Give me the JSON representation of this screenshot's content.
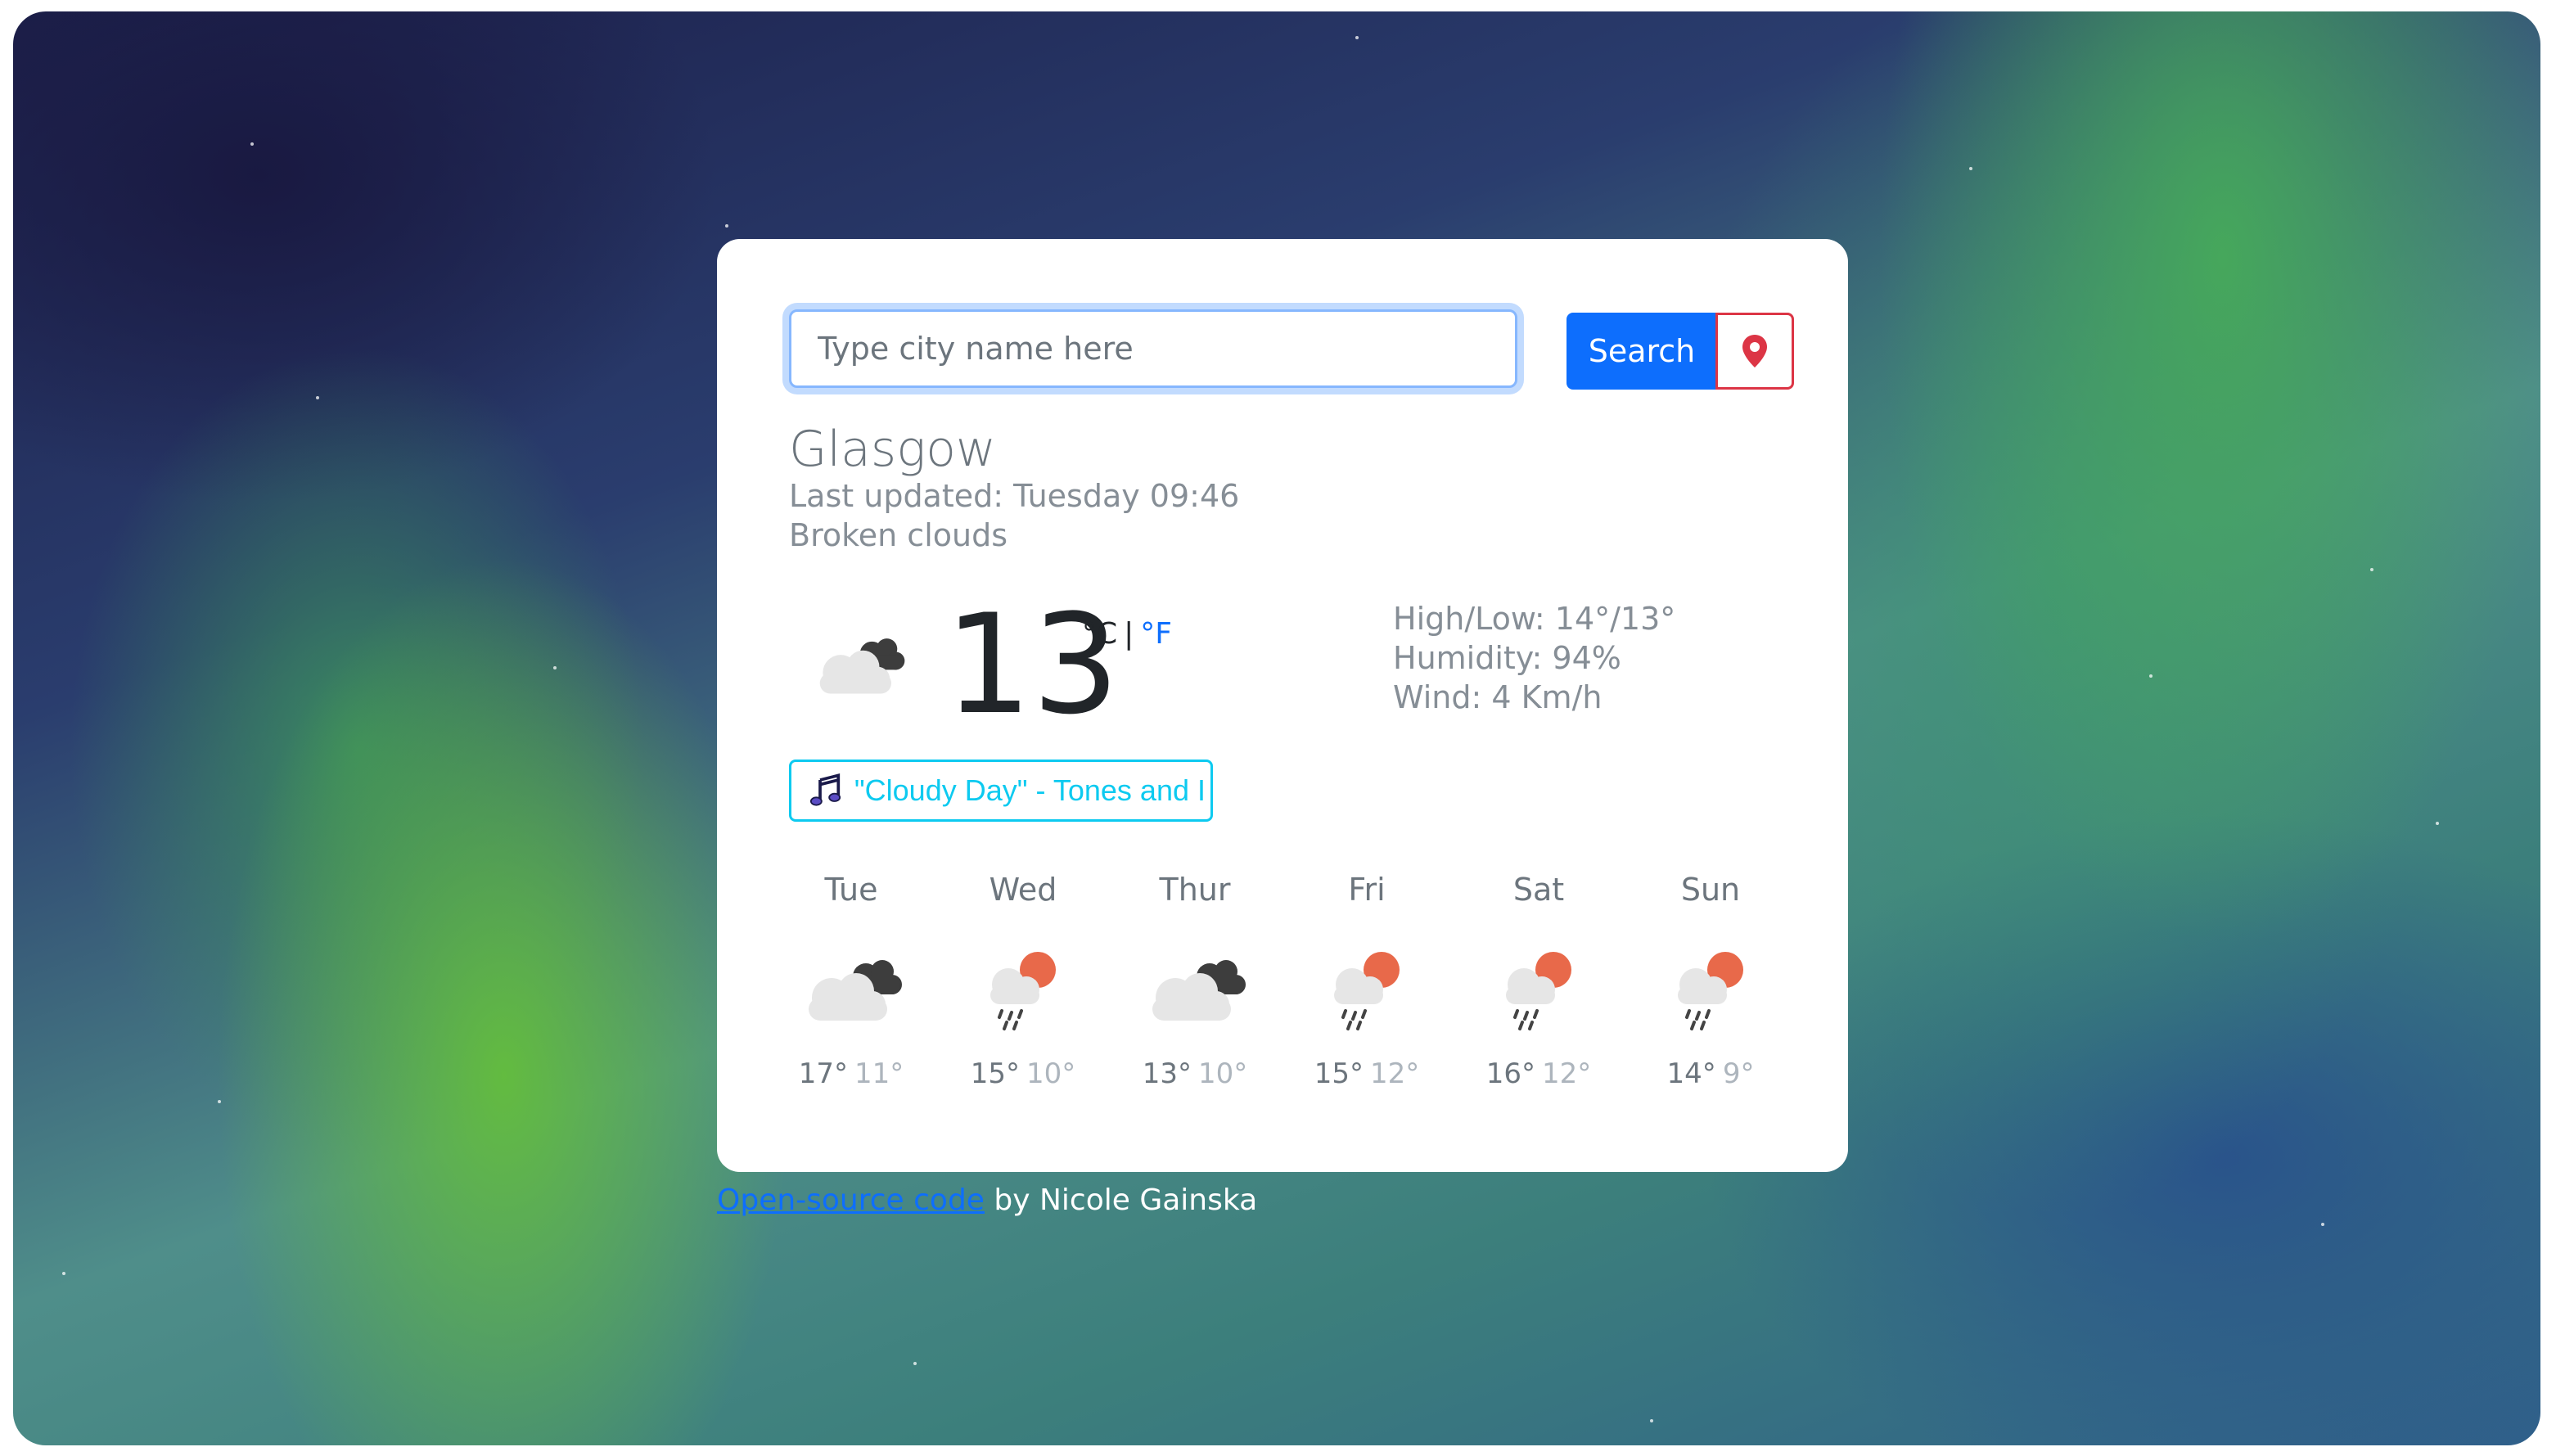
{
  "search": {
    "placeholder": "Type city name here",
    "button_label": "Search"
  },
  "current": {
    "city": "Glasgow",
    "last_updated": "Last updated: Tuesday 09:46",
    "description": "Broken clouds",
    "icon": "broken-clouds-icon",
    "temperature": "13",
    "unit_c": "°C",
    "unit_sep": "|",
    "unit_f": "°F",
    "high_low": "High/Low: 14°/13°",
    "humidity": "Humidity: 94%",
    "wind": "Wind: 4 Km/h"
  },
  "song": {
    "icon": "music-note-icon",
    "label": "\"Cloudy Day\" - Tones and I"
  },
  "forecast": [
    {
      "day": "Tue",
      "icon": "broken-clouds-icon",
      "high": "17°",
      "low": "11°"
    },
    {
      "day": "Wed",
      "icon": "sun-rain-icon",
      "high": "15°",
      "low": "10°"
    },
    {
      "day": "Thur",
      "icon": "broken-clouds-icon",
      "high": "13°",
      "low": "10°"
    },
    {
      "day": "Fri",
      "icon": "sun-rain-icon",
      "high": "15°",
      "low": "12°"
    },
    {
      "day": "Sat",
      "icon": "sun-rain-icon",
      "high": "16°",
      "low": "12°"
    },
    {
      "day": "Sun",
      "icon": "sun-rain-icon",
      "high": "14°",
      "low": "9°"
    }
  ],
  "footer": {
    "link_text": "Open-source code",
    "suffix": " by Nicole Gainska"
  },
  "colors": {
    "primary": "#0d6efd",
    "danger": "#dc3545",
    "info": "#0dcaf0",
    "sun": "#e8694a"
  }
}
